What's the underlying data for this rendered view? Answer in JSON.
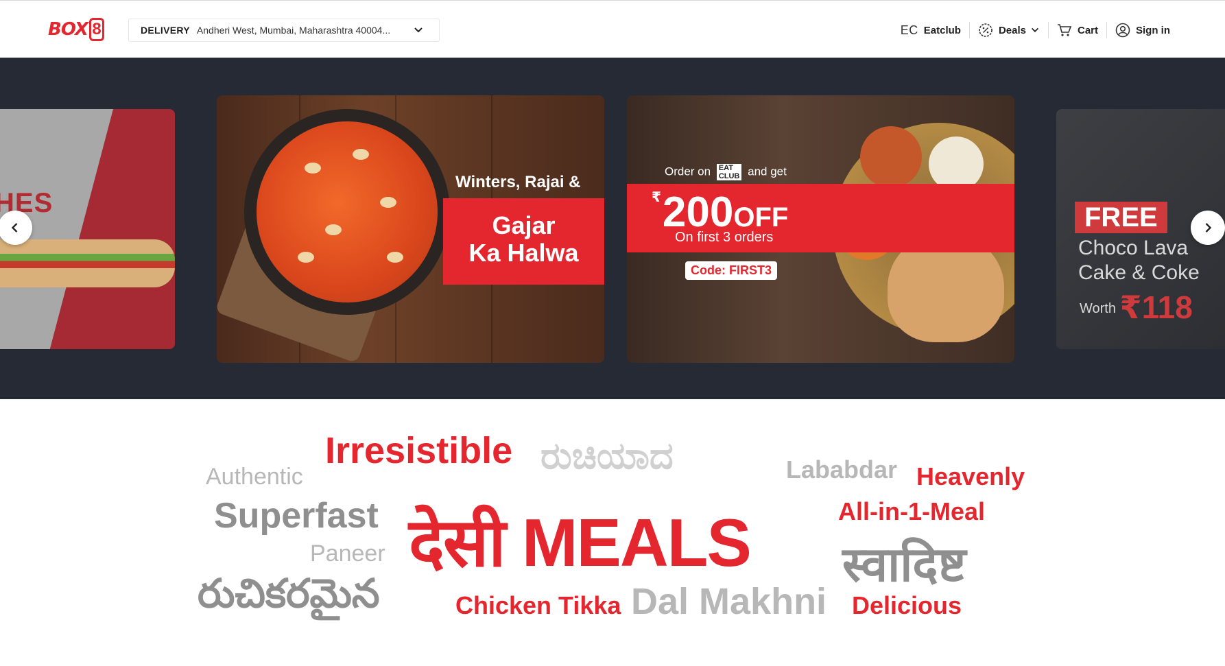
{
  "header": {
    "logo_text": "BOX",
    "logo_digit": "8",
    "delivery_label": "DELIVERY",
    "delivery_location": "Andheri West, Mumbai, Maharashtra 40004...",
    "nav": {
      "eatclub_mark": "EC",
      "eatclub_label": "Eatclub",
      "deals_label": "Deals",
      "cart_label": "Cart",
      "signin_label": "Sign in"
    }
  },
  "banner": {
    "slide_left": {
      "text": "HES"
    },
    "slide_mid": {
      "line1": "Winters, Rajai &",
      "line2": "Gajar",
      "line3": "Ka Halwa"
    },
    "slide_right": {
      "order_prefix": "Order on",
      "badge_top": "EAT",
      "badge_bottom": "CLUB",
      "order_suffix": "and get",
      "currency": "₹",
      "amount": "200",
      "off": "OFF",
      "first_orders": "On first 3 orders",
      "code": "Code: FIRST3"
    },
    "slide_far": {
      "free": "FREE",
      "line1": "Choco Lava",
      "line2": "Cake & Coke",
      "worth": "Worth",
      "currency": "₹",
      "price": "118"
    }
  },
  "word_cloud": {
    "irresistible": "Irresistible",
    "ruchiyada": "ರುಚಿಯಾದ",
    "lababdar": "Lababdar",
    "heavenly": "Heavenly",
    "authentic": "Authentic",
    "superfast": "Superfast",
    "desi_meals": "देसी MEALS",
    "all_in_1": "All-in-1-Meal",
    "paneer": "Paneer",
    "swadisht": "स्वादिष्ट",
    "ruchikaramaina": "రుచికరమైన",
    "chicken_tikka": "Chicken Tikka",
    "dal_makhni": "Dal Makhni",
    "delicious": "Delicious"
  },
  "colors": {
    "brand_red": "#e4262e",
    "banner_bg": "#262a35",
    "cloud_gray": "#8f8f8f"
  }
}
